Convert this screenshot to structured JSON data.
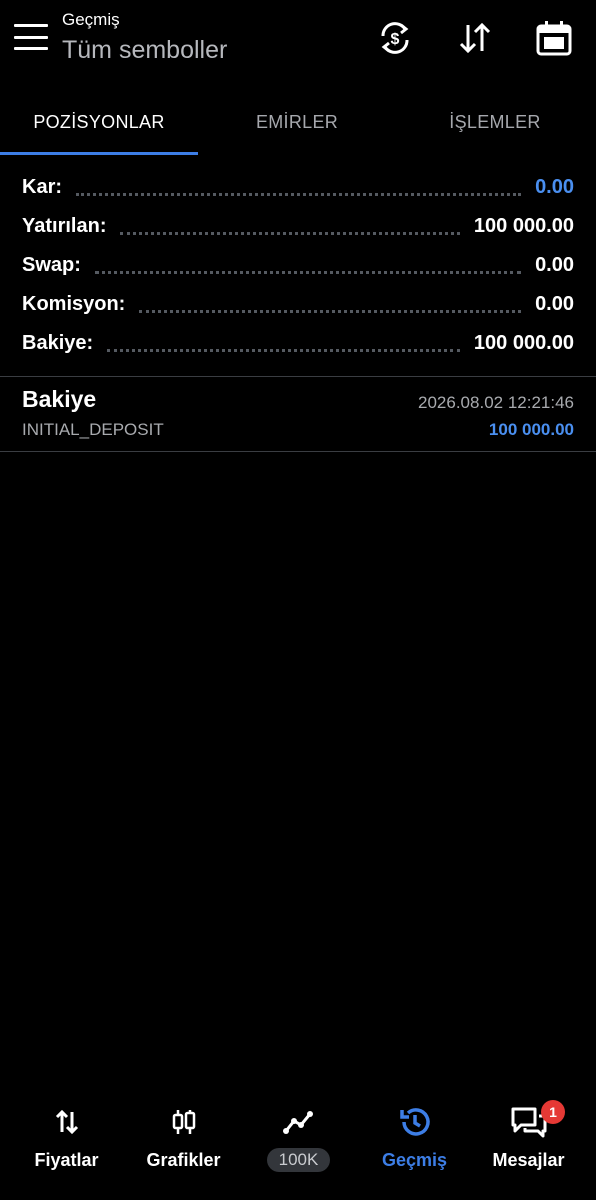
{
  "header": {
    "subtitle": "Geçmiş",
    "title": "Tüm semboller"
  },
  "tabs": [
    {
      "label": "POZİSYONLAR",
      "active": true
    },
    {
      "label": "EMİRLER",
      "active": false
    },
    {
      "label": "İŞLEMLER",
      "active": false
    }
  ],
  "summary": [
    {
      "label": "Kar:",
      "value": "0.00"
    },
    {
      "label": "Yatırılan:",
      "value": "100 000.00"
    },
    {
      "label": "Swap:",
      "value": "0.00"
    },
    {
      "label": "Komisyon:",
      "value": "0.00"
    },
    {
      "label": "Bakiye:",
      "value": "100 000.00"
    }
  ],
  "deal": {
    "title": "Bakiye",
    "time": "2026.08.02 12:21:46",
    "comment": "INITIAL_DEPOSIT",
    "amount": "100 000.00"
  },
  "bottom_nav": [
    {
      "label": "Fiyatlar",
      "icon": "up-down-arrows-icon"
    },
    {
      "label": "Grafikler",
      "icon": "candlestick-icon"
    },
    {
      "label": "100K",
      "icon": "trend-line-icon"
    },
    {
      "label": "Geçmiş",
      "icon": "history-clock-icon",
      "active": true
    },
    {
      "label": "Mesajlar",
      "icon": "messages-icon",
      "badge": "1"
    }
  ],
  "colors": {
    "background": "#000000",
    "accent": "#3d7ee6",
    "positive_value": "#4a8ff0",
    "badge": "#e53935"
  }
}
